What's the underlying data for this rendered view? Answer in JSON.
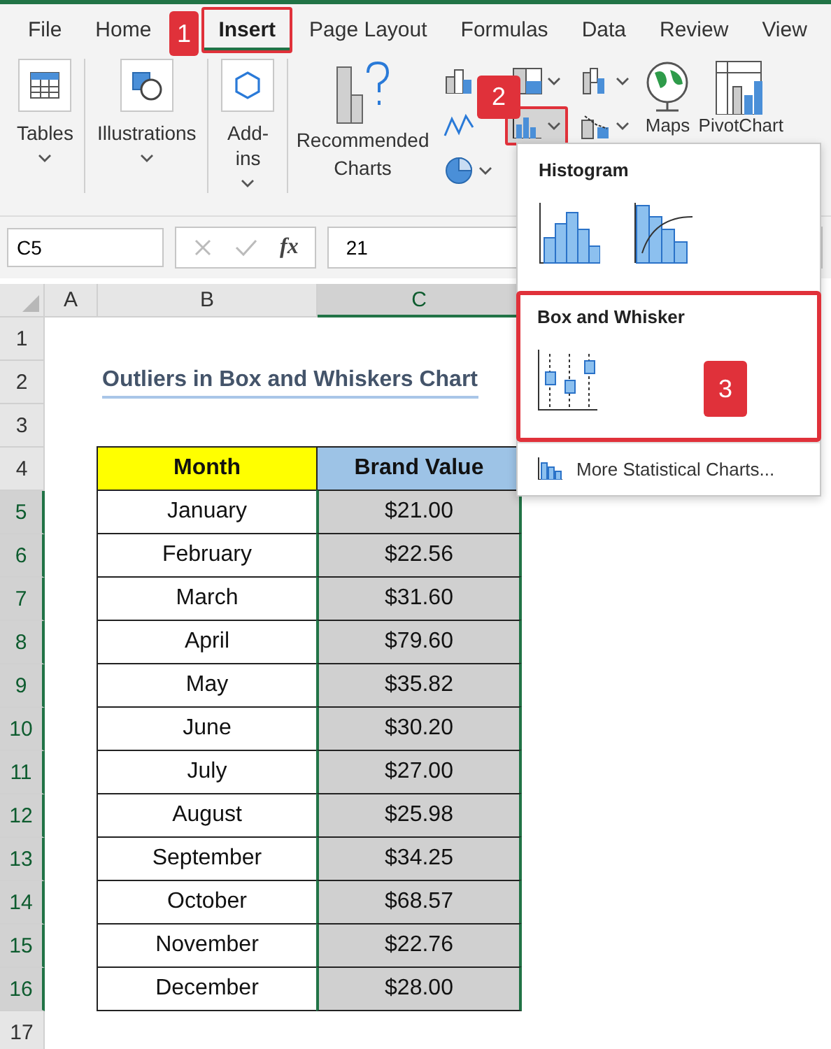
{
  "tabs": [
    {
      "label": "File",
      "selected": false,
      "marked": false
    },
    {
      "label": "Home",
      "selected": false,
      "marked": false
    },
    {
      "label": "Insert",
      "selected": true,
      "marked": true
    },
    {
      "label": "Page Layout",
      "selected": false,
      "marked": false
    },
    {
      "label": "Formulas",
      "selected": false,
      "marked": false
    },
    {
      "label": "Data",
      "selected": false,
      "marked": false
    },
    {
      "label": "Review",
      "selected": false,
      "marked": false
    },
    {
      "label": "View",
      "selected": false,
      "marked": false
    }
  ],
  "ribbon": {
    "groups": [
      {
        "label": "Tables",
        "kind": "table"
      },
      {
        "label": "Illustrations",
        "kind": "shapes"
      },
      {
        "label": "Add-ins",
        "kind": "addin"
      }
    ],
    "recommended": "Recommended Charts",
    "maps": "Maps",
    "pivot": "PivotChart",
    "statistic_button_marked": true
  },
  "formula_bar": {
    "name_box": "C5",
    "fx": "fx",
    "value": "21"
  },
  "columns": [
    {
      "label": "A",
      "selected": false
    },
    {
      "label": "B",
      "selected": false
    },
    {
      "label": "C",
      "selected": true
    }
  ],
  "row_headers": [
    {
      "label": "1",
      "selected": false
    },
    {
      "label": "2",
      "selected": false
    },
    {
      "label": "3",
      "selected": false
    },
    {
      "label": "4",
      "selected": false
    },
    {
      "label": "5",
      "selected": true
    },
    {
      "label": "6",
      "selected": true
    },
    {
      "label": "7",
      "selected": true
    },
    {
      "label": "8",
      "selected": true
    },
    {
      "label": "9",
      "selected": true
    },
    {
      "label": "10",
      "selected": true
    },
    {
      "label": "11",
      "selected": true
    },
    {
      "label": "12",
      "selected": true
    },
    {
      "label": "13",
      "selected": true
    },
    {
      "label": "14",
      "selected": true
    },
    {
      "label": "15",
      "selected": true
    },
    {
      "label": "16",
      "selected": true
    },
    {
      "label": "17",
      "selected": false
    }
  ],
  "sheet_title": "Outliers in Box and Whiskers Chart",
  "table": {
    "columns": [
      "Month",
      "Brand Value"
    ],
    "rows": [
      [
        "January",
        "$21.00"
      ],
      [
        "February",
        "$22.56"
      ],
      [
        "March",
        "$31.60"
      ],
      [
        "April",
        "$79.60"
      ],
      [
        "May",
        "$35.82"
      ],
      [
        "June",
        "$30.20"
      ],
      [
        "July",
        "$27.00"
      ],
      [
        "August",
        "$25.98"
      ],
      [
        "September",
        "$34.25"
      ],
      [
        "October",
        "$68.57"
      ],
      [
        "November",
        "$22.76"
      ],
      [
        "December",
        "$28.00"
      ]
    ]
  },
  "dropdown": {
    "sections": [
      {
        "title": "Histogram",
        "kind": "histogram",
        "marked": false
      },
      {
        "title": "Box and Whisker",
        "kind": "box",
        "marked": true
      }
    ],
    "more": "More Statistical Charts..."
  },
  "callouts": [
    "1",
    "2",
    "3"
  ]
}
